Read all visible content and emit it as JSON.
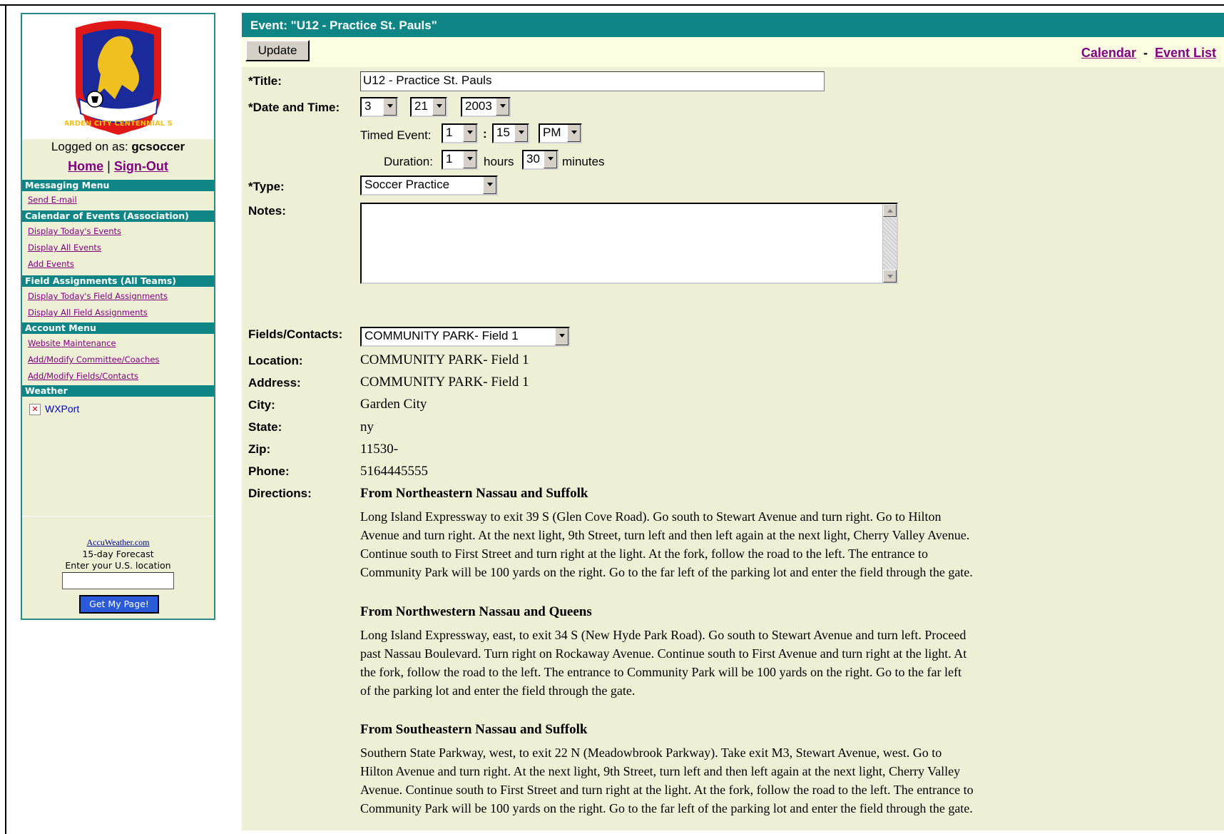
{
  "sidebar": {
    "logo_text": "GARDEN CITY CENTENNIAL S.C.",
    "logged_prefix": "Logged on as:",
    "username": "gcsoccer",
    "home_link": "Home",
    "separator": "|",
    "signout_link": "Sign-Out",
    "sections": [
      {
        "title": "Messaging Menu",
        "items": [
          "Send E-mail"
        ]
      },
      {
        "title": "Calendar of Events (Association)",
        "items": [
          "Display Today's Events",
          "Display All Events",
          "Add Events"
        ]
      },
      {
        "title": "Field Assignments (All Teams)",
        "items": [
          "Display Today's Field Assignments",
          "Display All Field Assignments"
        ]
      },
      {
        "title": "Account Menu",
        "items": [
          "Website Maintenance",
          "Add/Modify Committee/Coaches",
          "Add/Modify Fields/Contacts"
        ]
      },
      {
        "title": "Weather",
        "items": []
      }
    ],
    "weather_link": "WXPort",
    "accuweather": {
      "link": "AccuWeather.com",
      "line1": "15-day Forecast",
      "line2": "Enter your U.S. location",
      "input_value": "",
      "button": "Get My Page!"
    }
  },
  "header": {
    "title": "Event:  \"U12 - Practice St. Pauls\"",
    "update_button": "Update",
    "calendar_link": "Calendar",
    "link_separator": "-",
    "event_list_link": "Event List"
  },
  "form": {
    "title_label": "*Title:",
    "title_value": "U12 - Practice St. Pauls",
    "datetime_label": "*Date and Time:",
    "month": "3",
    "day": "21",
    "year": "2003",
    "timed_label": "Timed Event:",
    "hour": "1",
    "time_sep": ":",
    "minute": "15",
    "ampm": "PM",
    "duration_label": "Duration:",
    "duration_hours": "1",
    "hours_label": "hours",
    "duration_minutes": "30",
    "minutes_label": "minutes",
    "type_label": "*Type:",
    "type_value": "Soccer Practice",
    "notes_label": "Notes:",
    "notes_value": "",
    "fields_label": "Fields/Contacts:",
    "fields_value": "COMMUNITY PARK- Field 1"
  },
  "details": {
    "location_label": "Location:",
    "location": "COMMUNITY PARK- Field 1",
    "address_label": "Address:",
    "address": "COMMUNITY PARK- Field 1",
    "city_label": "City:",
    "city": "Garden City",
    "state_label": "State:",
    "state": "ny",
    "zip_label": "Zip:",
    "zip": "11530-",
    "phone_label": "Phone:",
    "phone": "5164445555",
    "directions_label": "Directions:"
  },
  "directions": [
    {
      "heading": "From Northeastern Nassau and Suffolk",
      "text": "Long Island Expressway to exit 39 S (Glen Cove Road). Go south to Stewart Avenue and turn right. Go to Hilton Avenue and turn right. At the next light, 9th Street, turn left and then left again at the next light, Cherry Valley Avenue. Continue south to First Street and turn right at the light. At the fork, follow the road to the left. The entrance to Community Park will be 100 yards on the right. Go to the far left of the parking lot and enter the field through the gate."
    },
    {
      "heading": "From Northwestern Nassau and Queens",
      "text": "Long Island Expressway, east, to exit 34 S (New Hyde Park Road). Go south to Stewart Avenue and turn left. Proceed past Nassau Boulevard. Turn right on Rockaway Avenue. Continue south to First Avenue and turn right at the light. At the fork, follow the road to the left. The entrance to Community Park will be 100 yards on the right. Go to the far left of the parking lot and enter the field through the gate."
    },
    {
      "heading": "From Southeastern Nassau and Suffolk",
      "text": "Southern State Parkway, west, to exit 22 N (Meadowbrook Parkway). Take exit M3, Stewart Avenue, west. Go to Hilton Avenue and turn right. At the next light, 9th Street, turn left and then left again at the next light, Cherry Valley Avenue. Continue south to First Street and turn right at the light. At the fork, follow the road to the left. The entrance to Community Park will be 100 yards on the right. Go to the far left of the parking lot and enter the field through the gate."
    }
  ],
  "colors": {
    "accent": "#0f8585",
    "page_bg": "#eef0d6",
    "link": "#800080"
  }
}
